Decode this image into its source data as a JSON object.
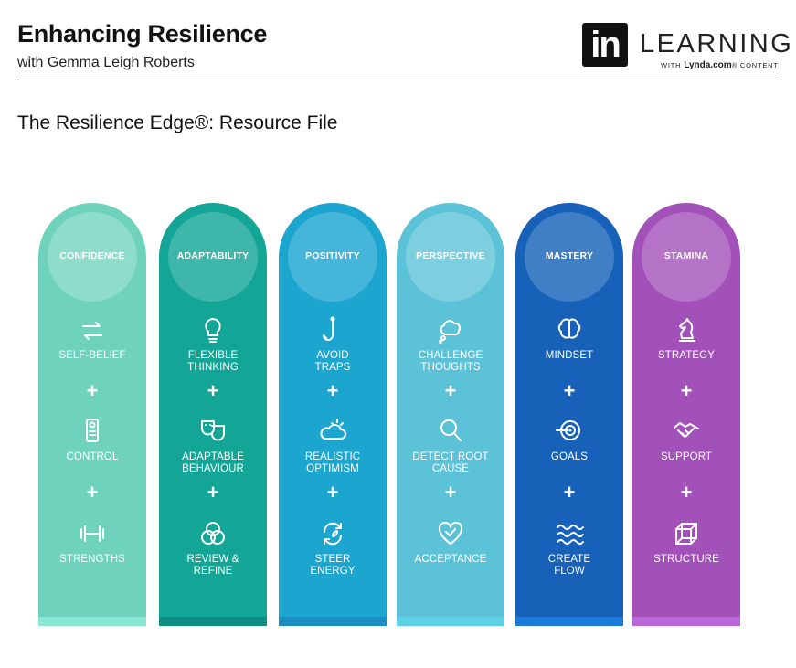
{
  "header": {
    "course_title": "Enhancing Resilience",
    "course_author": "with Gemma Leigh Roberts",
    "logo_mark": "in",
    "logo_word": "LEARNING",
    "logo_sub_prefix": "WITH ",
    "logo_sub_brand": "Lynda.com",
    "logo_sub_suffix": "® CONTENT"
  },
  "document_title": "The Resilience Edge®: Resource File",
  "pillars": [
    {
      "name": "CONFIDENCE",
      "color": "#6fd2bd",
      "circle": "#8edccb",
      "base": "#8ce6d4",
      "items": [
        {
          "label": "SELF-BELIEF",
          "icon": "arrows-exchange-icon"
        },
        {
          "label": "CONTROL",
          "icon": "remote-control-icon"
        },
        {
          "label": "STRENGTHS",
          "icon": "dumbbell-icon"
        }
      ]
    },
    {
      "name": "ADAPTABILITY",
      "color": "#13a596",
      "circle": "#3fb6aa",
      "base": "#0f8d80",
      "items": [
        {
          "label": "FLEXIBLE\nTHINKING",
          "icon": "lightbulb-icon"
        },
        {
          "label": "ADAPTABLE\nBEHAVIOUR",
          "icon": "theatre-masks-icon"
        },
        {
          "label": "REVIEW &\nREFINE",
          "icon": "venn-diagram-icon"
        }
      ]
    },
    {
      "name": "POSITIVITY",
      "color": "#1ba5cf",
      "circle": "#45b6da",
      "base": "#1b8ec3",
      "items": [
        {
          "label": "AVOID\nTRAPS",
          "icon": "hook-icon"
        },
        {
          "label": "REALISTIC\nOPTIMISM",
          "icon": "sun-cloud-icon"
        },
        {
          "label": "STEER\nENERGY",
          "icon": "recycle-leaf-icon"
        }
      ]
    },
    {
      "name": "PERSPECTIVE",
      "color": "#5cc2d7",
      "circle": "#7dcfe0",
      "base": "#5dd0e6",
      "items": [
        {
          "label": "CHALLENGE\nTHOUGHTS",
          "icon": "thought-bubble-icon"
        },
        {
          "label": "DETECT ROOT\nCAUSE",
          "icon": "magnifier-icon"
        },
        {
          "label": "ACCEPTANCE",
          "icon": "heart-icon"
        }
      ]
    },
    {
      "name": "MASTERY",
      "color": "#1762b8",
      "circle": "#3f7fc6",
      "base": "#1a7ad8",
      "items": [
        {
          "label": "MINDSET",
          "icon": "brain-icon"
        },
        {
          "label": "GOALS",
          "icon": "target-icon"
        },
        {
          "label": "CREATE\nFLOW",
          "icon": "waves-icon"
        }
      ]
    },
    {
      "name": "STAMINA",
      "color": "#a151b8",
      "circle": "#b473c6",
      "base": "#b868d8",
      "items": [
        {
          "label": "STRATEGY",
          "icon": "chess-knight-icon"
        },
        {
          "label": "SUPPORT",
          "icon": "handshake-icon"
        },
        {
          "label": "STRUCTURE",
          "icon": "cube-icon"
        }
      ]
    }
  ],
  "plus_symbol": "+"
}
